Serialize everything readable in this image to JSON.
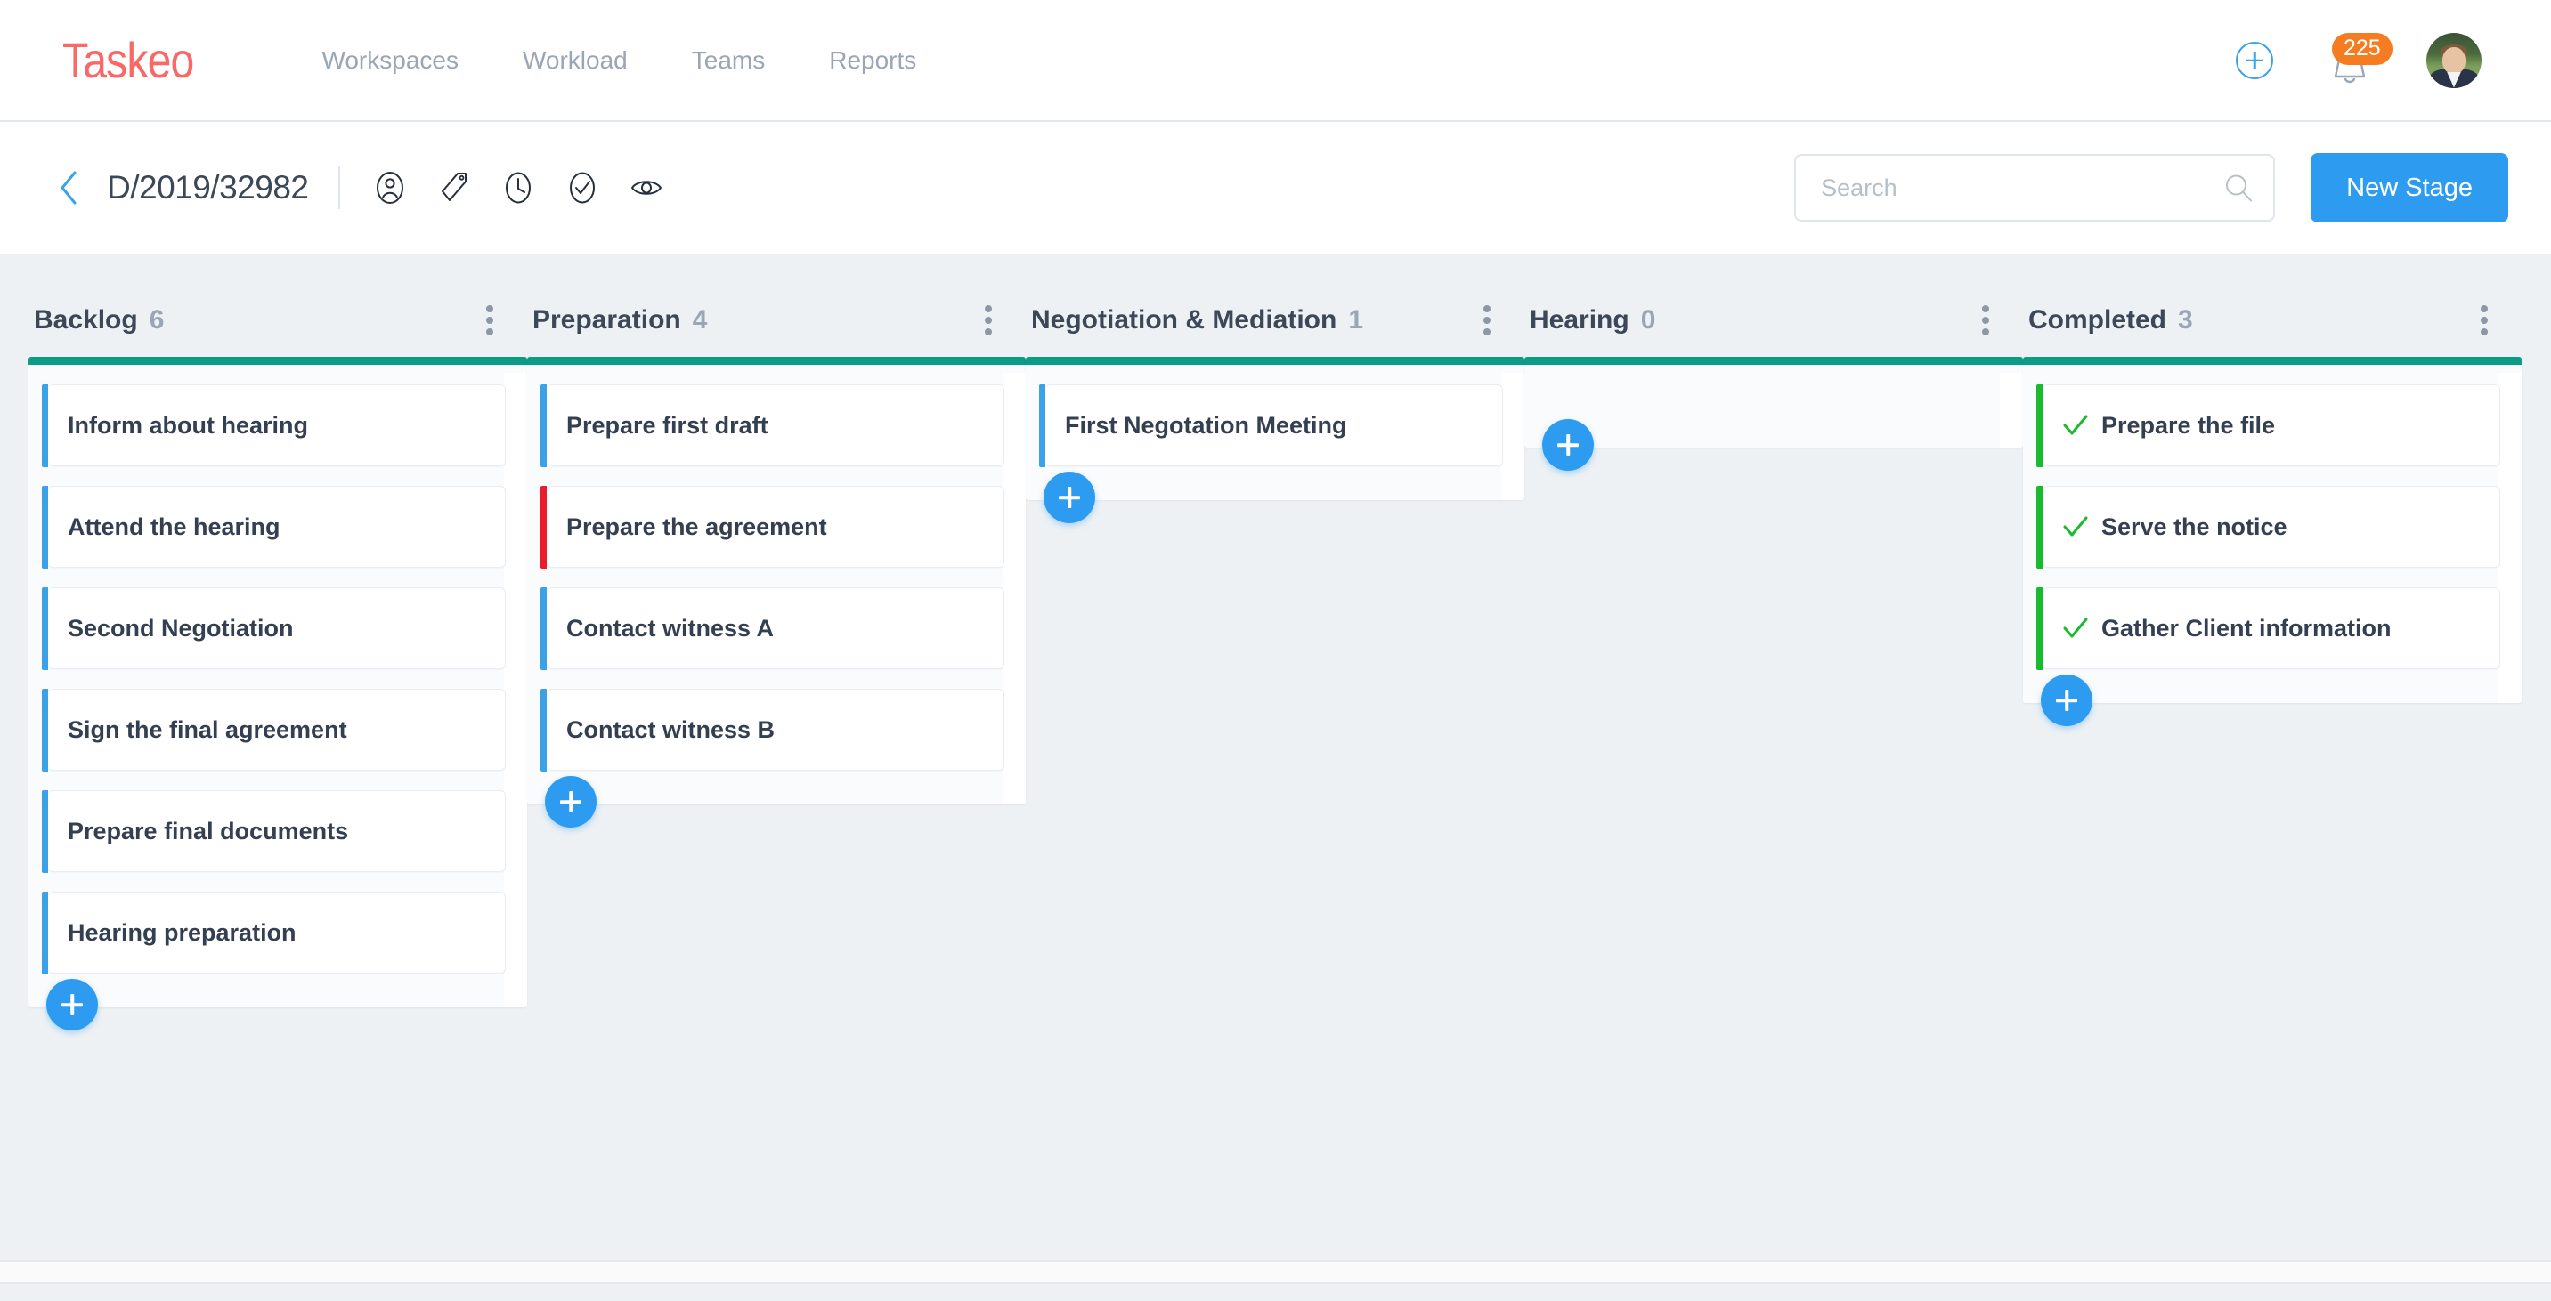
{
  "app": {
    "brand": "Taskeo",
    "nav": [
      {
        "label": "Workspaces"
      },
      {
        "label": "Workload"
      },
      {
        "label": "Teams"
      },
      {
        "label": "Reports"
      }
    ],
    "add_icon": "plus-circle-icon",
    "notifications": {
      "icon": "bell-icon",
      "count": "225",
      "badge_color": "#f57c20"
    },
    "avatar_icon": "user-avatar",
    "brand_color": "#fa6767",
    "accent_color": "#2d9cf0"
  },
  "toolbar": {
    "back_icon": "chevron-left-icon",
    "title": "D/2019/32982",
    "icons": [
      {
        "name": "user-circle-icon"
      },
      {
        "name": "tag-icon"
      },
      {
        "name": "clock-icon"
      },
      {
        "name": "check-circle-icon"
      },
      {
        "name": "eye-icon"
      }
    ],
    "search": {
      "value": "",
      "placeholder": "Search",
      "icon": "search-icon"
    },
    "new_stage_label": "New Stage"
  },
  "board": {
    "stage_bar_color": "#0b9c85",
    "columns": [
      {
        "title": "Backlog",
        "count": "6",
        "menu_icon": "more-vertical-icon",
        "add_icon": "plus-icon",
        "cards": [
          {
            "title": "Inform about hearing",
            "strip": "#3ba2e8",
            "done": false
          },
          {
            "title": "Attend the hearing",
            "strip": "#3ba2e8",
            "done": false
          },
          {
            "title": "Second Negotiation",
            "strip": "#3ba2e8",
            "done": false
          },
          {
            "title": "Sign the final agreement",
            "strip": "#3ba2e8",
            "done": false
          },
          {
            "title": "Prepare final documents",
            "strip": "#3ba2e8",
            "done": false
          },
          {
            "title": "Hearing preparation",
            "strip": "#3ba2e8",
            "done": false
          }
        ]
      },
      {
        "title": "Preparation",
        "count": "4",
        "menu_icon": "more-vertical-icon",
        "add_icon": "plus-icon",
        "cards": [
          {
            "title": "Prepare first draft",
            "strip": "#3ba2e8",
            "done": false
          },
          {
            "title": "Prepare the agreement",
            "strip": "#ea1c2d",
            "done": false
          },
          {
            "title": "Contact witness A",
            "strip": "#3ba2e8",
            "done": false
          },
          {
            "title": "Contact witness B",
            "strip": "#3ba2e8",
            "done": false
          }
        ]
      },
      {
        "title": "Negotiation & Mediation",
        "count": "1",
        "menu_icon": "more-vertical-icon",
        "add_icon": "plus-icon",
        "cards": [
          {
            "title": "First Negotation Meeting",
            "strip": "#3ba2e8",
            "done": false
          }
        ]
      },
      {
        "title": "Hearing",
        "count": "0",
        "menu_icon": "more-vertical-icon",
        "add_icon": "plus-icon",
        "cards": []
      },
      {
        "title": "Completed",
        "count": "3",
        "menu_icon": "more-vertical-icon",
        "add_icon": "plus-icon",
        "cards": [
          {
            "title": "Prepare the file",
            "strip": "#18bb2e",
            "done": true
          },
          {
            "title": "Serve the notice",
            "strip": "#18bb2e",
            "done": true
          },
          {
            "title": "Gather Client information",
            "strip": "#18bb2e",
            "done": true
          }
        ]
      }
    ]
  }
}
